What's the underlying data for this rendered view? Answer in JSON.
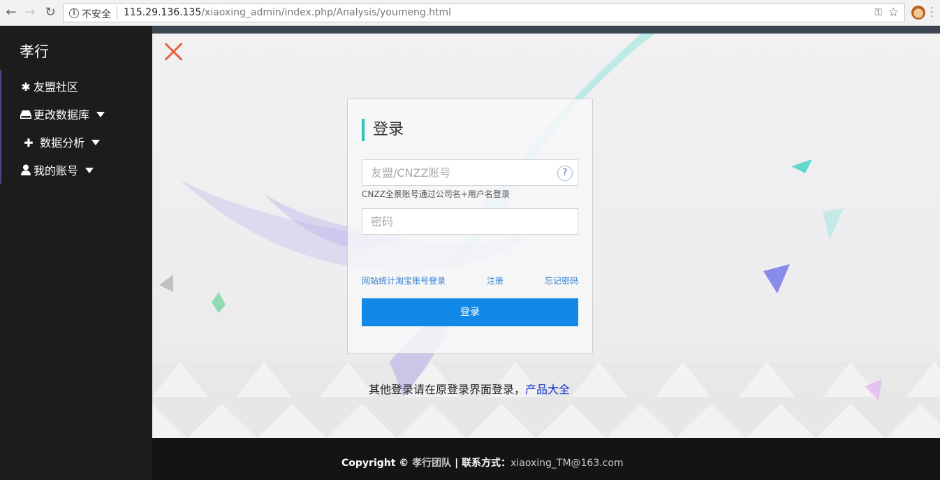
{
  "browser": {
    "security_label": "不安全",
    "url_host": "115.29.136.135",
    "url_path": "/xiaoxing_admin/index.php/Analysis/youmeng.html",
    "icons": [
      "back-icon",
      "forward-icon",
      "reload-icon",
      "info-icon",
      "key-icon",
      "star-icon",
      "extension-icon",
      "menu-icon"
    ]
  },
  "sidebar": {
    "brand": "孝行",
    "items": [
      {
        "icon": "asterisk-icon",
        "label": "友盟社区",
        "has_caret": false
      },
      {
        "icon": "drive-icon",
        "label": "更改数据库",
        "has_caret": true
      },
      {
        "icon": "plus-icon",
        "label": "数据分析",
        "has_caret": true
      },
      {
        "icon": "user-icon",
        "label": "我的账号",
        "has_caret": true
      }
    ]
  },
  "login": {
    "title": "登录",
    "account_placeholder": "友盟/CNZZ账号",
    "help_label": "?",
    "hint": "CNZZ全景账号通过公司名+用户名登录",
    "password_placeholder": "密码",
    "link_taobao": "网站统计淘宝账号登录",
    "link_register": "注册",
    "link_forgot": "忘记密码",
    "submit_label": "登录",
    "other_text": "其他登录请在原登录界面登录，",
    "other_link": "产品大全"
  },
  "footer": {
    "copyright": "Copyright ©",
    "team": "孝行团队",
    "separator": "|",
    "contact_label": "联系方式：",
    "email": "xiaoxing_TM@163.com"
  },
  "colors": {
    "accent": "#1289e8",
    "title_bar": "#27c8b8",
    "close": "#e8623c",
    "sidebar_bg": "#1c1c1c"
  }
}
